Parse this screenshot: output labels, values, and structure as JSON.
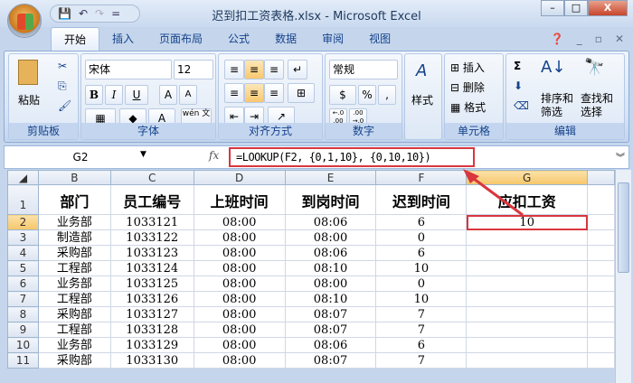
{
  "window": {
    "title": "迟到扣工资表格.xlsx - Microsoft Excel",
    "minimize": "–",
    "maximize": "□",
    "close": "X"
  },
  "qat": {
    "save": "💾",
    "undo": "↶",
    "redo": "↷",
    "customize": "="
  },
  "tabs": [
    "开始",
    "插入",
    "页面布局",
    "公式",
    "数据",
    "审阅",
    "视图"
  ],
  "ribbon": {
    "clipboard": {
      "label": "剪贴板",
      "paste": "粘贴"
    },
    "font": {
      "label": "字体",
      "name": "宋体",
      "size": "12",
      "bold": "B",
      "italic": "I",
      "underline": "U",
      "grow": "A",
      "shrink": "A",
      "phonetic": "wén 文"
    },
    "alignment": {
      "label": "对齐方式"
    },
    "number": {
      "label": "数字",
      "format": "常规",
      "percent": "%",
      "comma": ",",
      "inc": "←.0 .00",
      "dec": ".00 →.0"
    },
    "styles": {
      "label": "样式"
    },
    "cells": {
      "label": "单元格",
      "insert": "插入",
      "delete": "删除",
      "format": "格式"
    },
    "editing": {
      "label": "编辑",
      "sum": "Σ",
      "sort": "排序和筛选",
      "find": "查找和选择"
    }
  },
  "formula_bar": {
    "name_box": "G2",
    "fx": "fx",
    "formula": "=LOOKUP(F2, {0,1,10}, {0,10,10})"
  },
  "columns": [
    "B",
    "C",
    "D",
    "E",
    "F",
    "G"
  ],
  "headers": [
    "部门",
    "员工编号",
    "上班时间",
    "到岗时间",
    "迟到时间",
    "应扣工资"
  ],
  "rows": [
    [
      "业务部",
      "1033121",
      "08:00",
      "08:06",
      "6",
      "10"
    ],
    [
      "制造部",
      "1033122",
      "08:00",
      "08:00",
      "0",
      ""
    ],
    [
      "采购部",
      "1033123",
      "08:00",
      "08:06",
      "6",
      ""
    ],
    [
      "工程部",
      "1033124",
      "08:00",
      "08:10",
      "10",
      ""
    ],
    [
      "业务部",
      "1033125",
      "08:00",
      "08:00",
      "0",
      ""
    ],
    [
      "工程部",
      "1033126",
      "08:00",
      "08:10",
      "10",
      ""
    ],
    [
      "采购部",
      "1033127",
      "08:00",
      "08:07",
      "7",
      ""
    ],
    [
      "工程部",
      "1033128",
      "08:00",
      "08:07",
      "7",
      ""
    ],
    [
      "业务部",
      "1033129",
      "08:00",
      "08:06",
      "6",
      ""
    ],
    [
      "采购部",
      "1033130",
      "08:00",
      "08:07",
      "7",
      ""
    ]
  ],
  "accent": "#d9363e"
}
